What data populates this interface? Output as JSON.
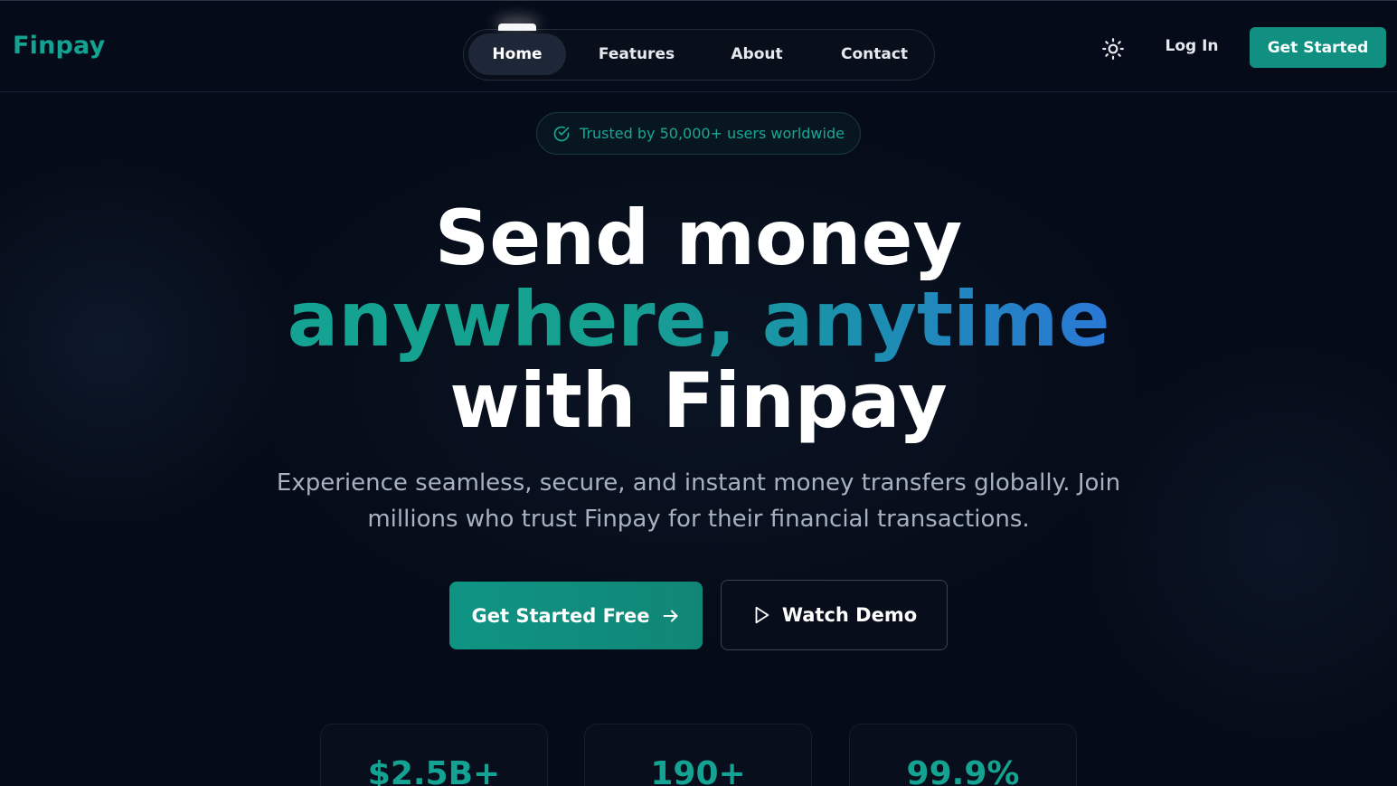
{
  "brand": {
    "name": "Finpay",
    "accent": "#14a392"
  },
  "nav": {
    "items": [
      {
        "label": "Home",
        "active": true
      },
      {
        "label": "Features",
        "active": false
      },
      {
        "label": "About",
        "active": false
      },
      {
        "label": "Contact",
        "active": false
      }
    ],
    "theme_icon": "sun-icon",
    "login_label": "Log In",
    "cta_label": "Get Started"
  },
  "hero": {
    "badge_icon": "check-circle-icon",
    "badge_text": "Trusted by 50,000+ users worldwide",
    "line1": "Send money",
    "line2": "anywhere, anytime",
    "line3": "with Finpay",
    "subtitle": "Experience seamless, secure, and instant money transfers globally. Join millions who trust Finpay for their financial transactions.",
    "primary_cta": "Get Started Free",
    "primary_cta_icon": "arrow-right-icon",
    "secondary_cta": "Watch Demo",
    "secondary_cta_icon": "play-icon"
  },
  "stats": [
    {
      "value": "$2.5B+"
    },
    {
      "value": "190+"
    },
    {
      "value": "99.9%"
    }
  ]
}
